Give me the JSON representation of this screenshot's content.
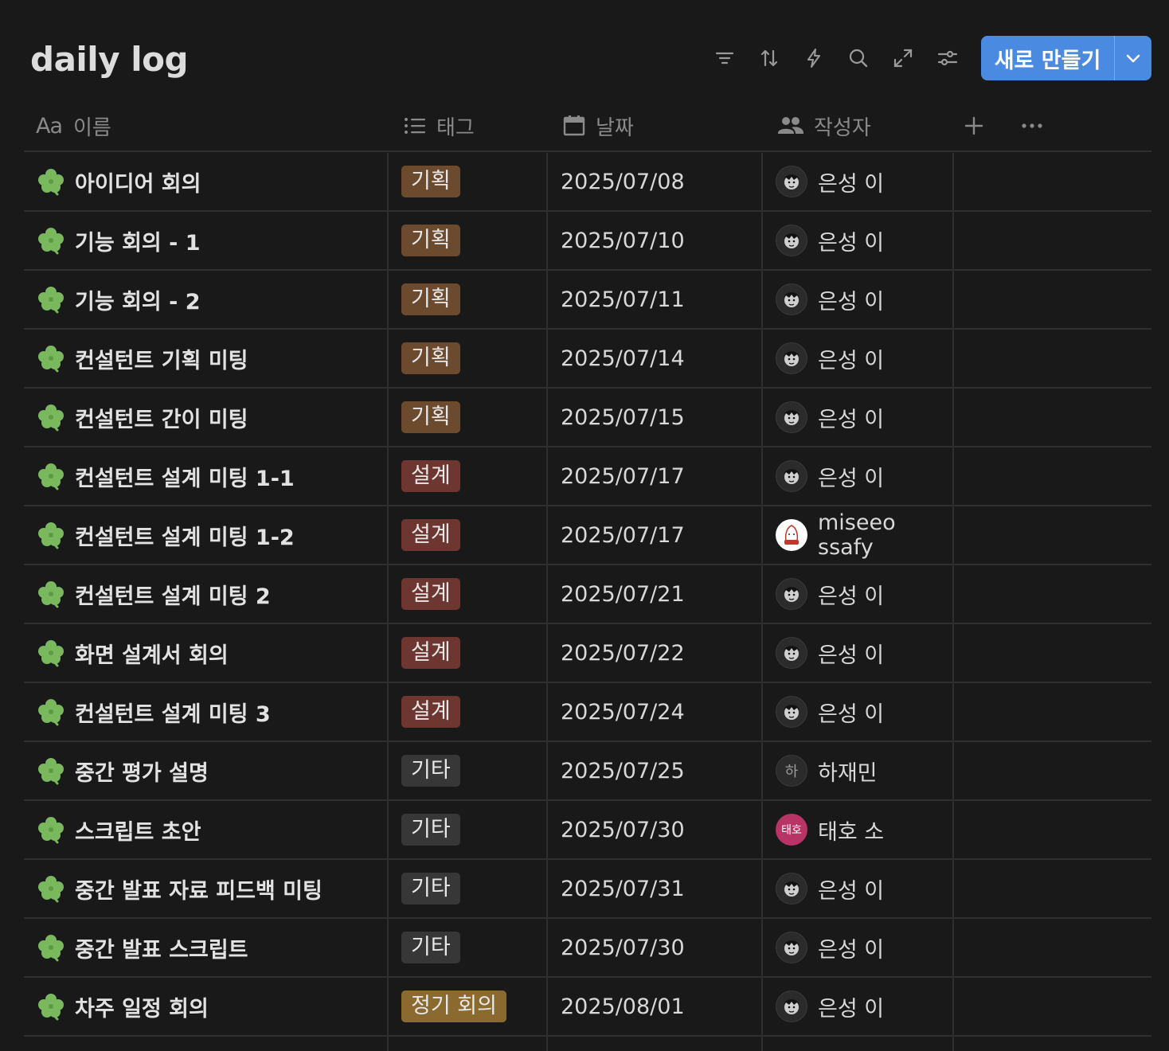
{
  "title": "daily log",
  "toolbar": {
    "new_label": "새로 만들기",
    "accent": "#4a8ae0"
  },
  "columns": {
    "name": "이름",
    "name_icon": "Aa",
    "tag": "태그",
    "date": "날짜",
    "author": "작성자"
  },
  "tag_colors": {
    "기획": "#6b4a2e",
    "설계": "#6e3630",
    "기타": "#373737",
    "정기 회의": "#8a6a2e"
  },
  "rows": [
    {
      "name": "아이디어 회의",
      "tag": "기획",
      "date": "2025/07/08",
      "author": "은성 이",
      "avatar": "default"
    },
    {
      "name": "기능 회의 - 1",
      "tag": "기획",
      "date": "2025/07/10",
      "author": "은성 이",
      "avatar": "default"
    },
    {
      "name": "기능 회의 - 2",
      "tag": "기획",
      "date": "2025/07/11",
      "author": "은성 이",
      "avatar": "default"
    },
    {
      "name": "컨설턴트 기획 미팅",
      "tag": "기획",
      "date": "2025/07/14",
      "author": "은성 이",
      "avatar": "default"
    },
    {
      "name": "컨설턴트 간이 미팅",
      "tag": "기획",
      "date": "2025/07/15",
      "author": "은성 이",
      "avatar": "default"
    },
    {
      "name": "컨설턴트 설계 미팅 1-1",
      "tag": "설계",
      "date": "2025/07/17",
      "author": "은성 이",
      "avatar": "default"
    },
    {
      "name": "컨설턴트 설계 미팅 1-2",
      "tag": "설계",
      "date": "2025/07/17",
      "author": "miseeo ssafy",
      "avatar": "white"
    },
    {
      "name": "컨설턴트 설계 미팅 2",
      "tag": "설계",
      "date": "2025/07/21",
      "author": "은성 이",
      "avatar": "default"
    },
    {
      "name": "화면 설계서 회의",
      "tag": "설계",
      "date": "2025/07/22",
      "author": "은성 이",
      "avatar": "default"
    },
    {
      "name": "컨설턴트 설계 미팅 3",
      "tag": "설계",
      "date": "2025/07/24",
      "author": "은성 이",
      "avatar": "default"
    },
    {
      "name": "중간 평가 설명",
      "tag": "기타",
      "date": "2025/07/25",
      "author": "하재민",
      "avatar": "letter",
      "avatar_text": "하"
    },
    {
      "name": "스크립트 초안",
      "tag": "기타",
      "date": "2025/07/30",
      "author": "태호 소",
      "avatar": "pink",
      "avatar_text": "태호"
    },
    {
      "name": "중간 발표 자료 피드백 미팅",
      "tag": "기타",
      "date": "2025/07/31",
      "author": "은성 이",
      "avatar": "default"
    },
    {
      "name": "중간 발표 스크립트",
      "tag": "기타",
      "date": "2025/07/30",
      "author": "은성 이",
      "avatar": "default"
    },
    {
      "name": "차주 일정 회의",
      "tag": "정기 회의",
      "date": "2025/08/01",
      "author": "은성 이",
      "avatar": "default"
    }
  ]
}
